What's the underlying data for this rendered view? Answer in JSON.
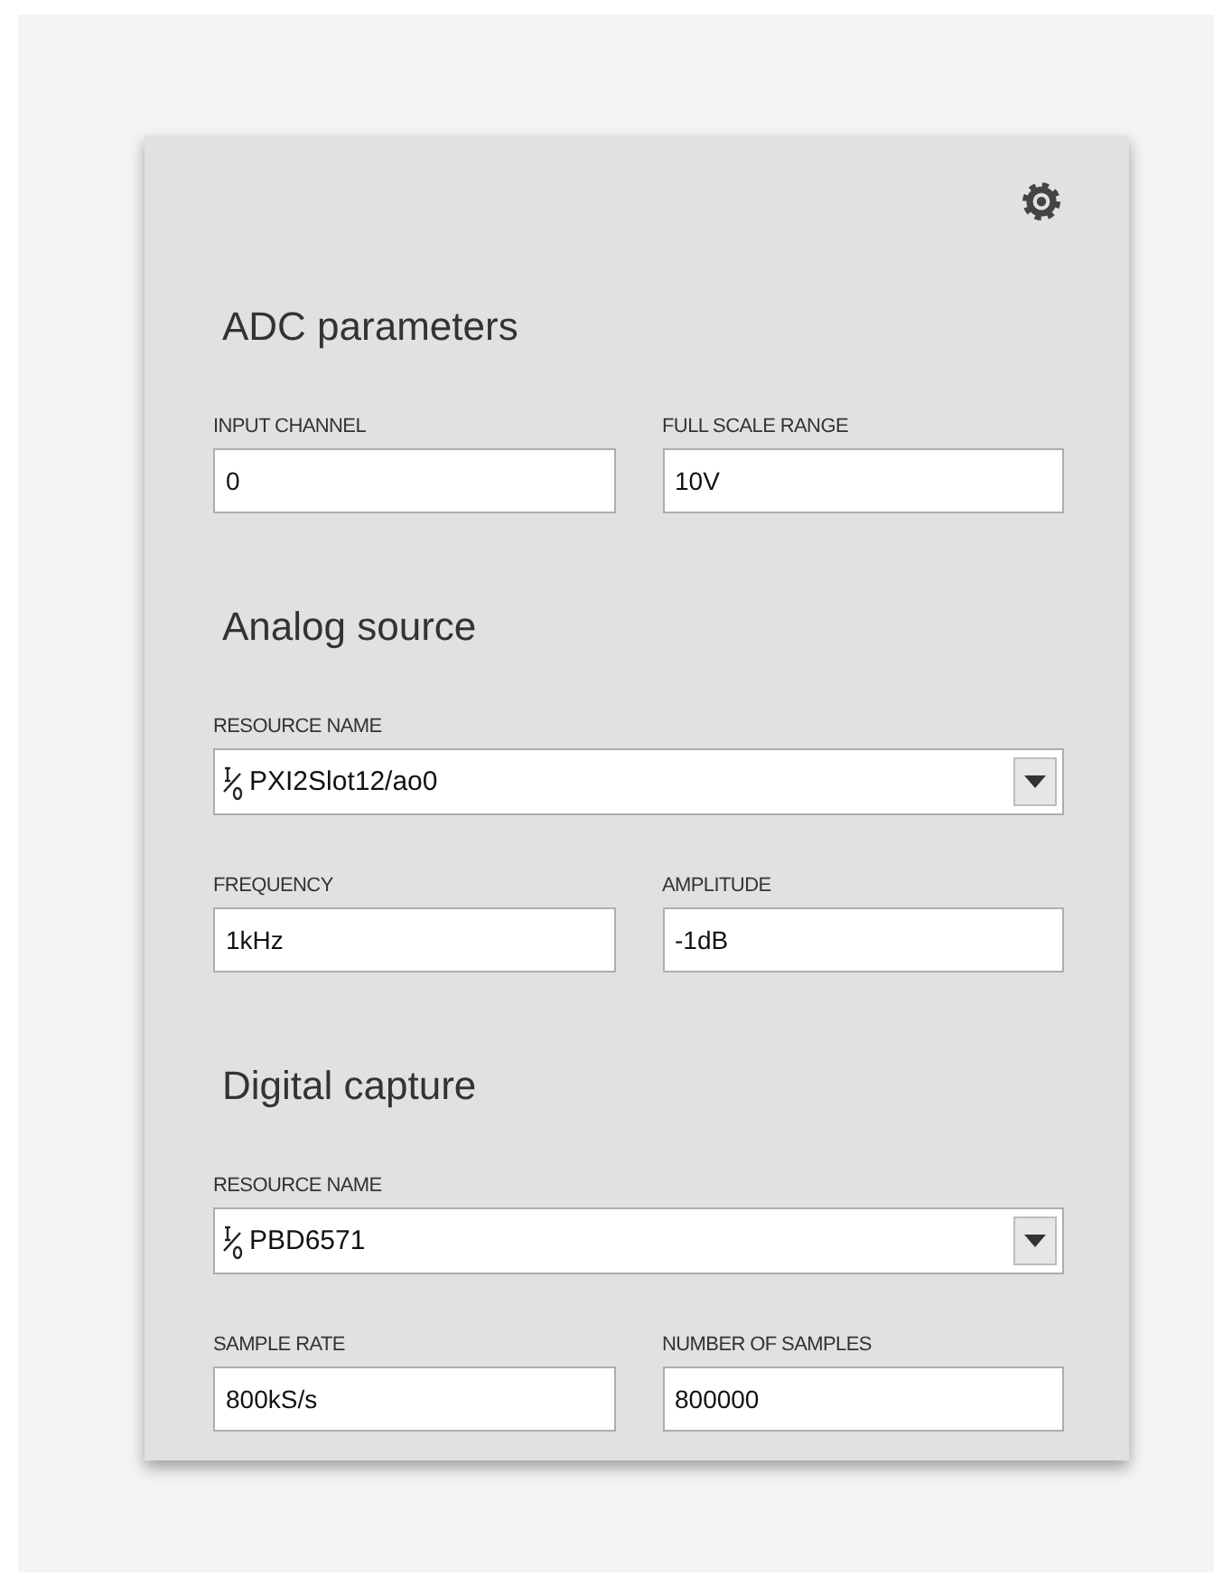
{
  "sections": [
    {
      "title": "ADC parameters",
      "rows": [
        {
          "fields": [
            {
              "kind": "text",
              "label": "INPUT CHANNEL",
              "value": "0"
            },
            {
              "kind": "text",
              "label": "FULL SCALE RANGE",
              "value": "10V"
            }
          ]
        }
      ]
    },
    {
      "title": "Analog source",
      "rows": [
        {
          "fields": [
            {
              "kind": "combo",
              "label": "RESOURCE NAME",
              "value": "PXI2Slot12/ao0"
            }
          ]
        },
        {
          "fields": [
            {
              "kind": "text",
              "label": "FREQUENCY",
              "value": "1kHz"
            },
            {
              "kind": "text",
              "label": "AMPLITUDE",
              "value": "-1dB"
            }
          ]
        }
      ]
    },
    {
      "title": "Digital capture",
      "rows": [
        {
          "fields": [
            {
              "kind": "combo",
              "label": "RESOURCE NAME",
              "value": "PBD6571"
            }
          ]
        },
        {
          "fields": [
            {
              "kind": "text",
              "label": "SAMPLE RATE",
              "value": "800kS/s"
            },
            {
              "kind": "text",
              "label": "NUMBER OF SAMPLES",
              "value": "800000"
            }
          ]
        }
      ]
    }
  ]
}
